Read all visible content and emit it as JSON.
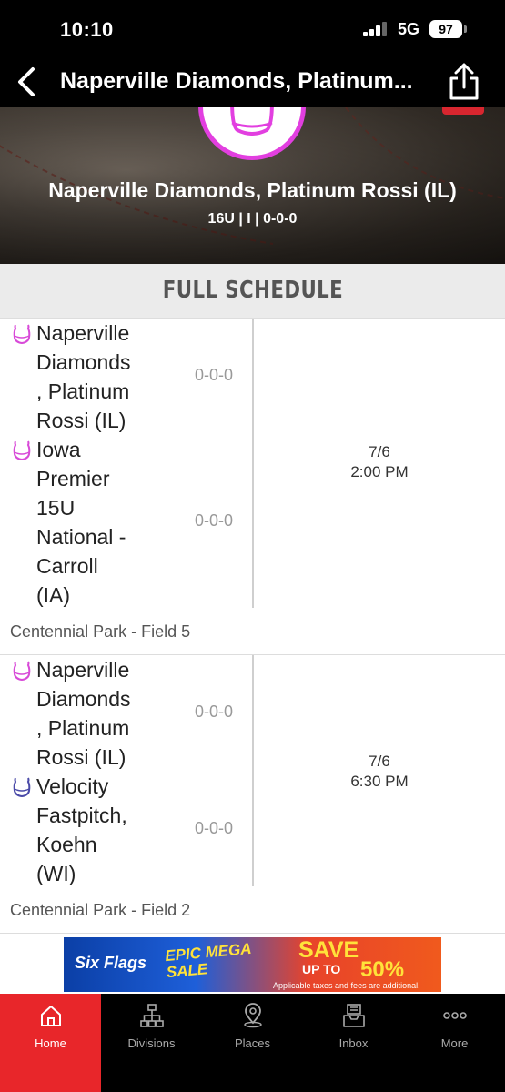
{
  "status_bar": {
    "time": "10:10",
    "network": "5G",
    "battery": "97"
  },
  "nav": {
    "title": "Naperville Diamonds, Platinum...",
    "back_icon": "chevron-left-icon",
    "share_icon": "share-icon"
  },
  "hero": {
    "team_name": "Naperville Diamonds, Platinum Rossi (IL)",
    "record": "16U | I | 0-0-0"
  },
  "schedule": {
    "header": "FULL SCHEDULE",
    "games": [
      {
        "home": {
          "name_lines": [
            "Naperville",
            "Diamonds",
            ", Platinum",
            "Rossi (IL)"
          ],
          "record": "0-0-0",
          "icon_color": "#d84ad8"
        },
        "away": {
          "name_lines": [
            "Iowa",
            "Premier",
            "15U",
            "National -",
            "Carroll",
            "(IA)"
          ],
          "record": "0-0-0",
          "icon_color": "#d84ad8"
        },
        "date": "7/6",
        "time": "2:00 PM",
        "location": "Centennial Park - Field 5"
      },
      {
        "home": {
          "name_lines": [
            "Naperville",
            "Diamonds",
            ", Platinum",
            "Rossi (IL)"
          ],
          "record": "0-0-0",
          "icon_color": "#d84ad8"
        },
        "away": {
          "name_lines": [
            "Velocity",
            "Fastpitch,",
            "Koehn",
            "(WI)"
          ],
          "record": "0-0-0",
          "icon_color": "#4a4aa8"
        },
        "date": "7/6",
        "time": "6:30 PM",
        "location": "Centennial Park - Field 2"
      }
    ]
  },
  "ad": {
    "brand": "Six Flags",
    "headline_1": "EPIC MEGA",
    "headline_2": "SALE",
    "save": "SAVE",
    "up_to": "UP TO",
    "percent": "50%",
    "fine_print": "Applicable taxes and fees are additional."
  },
  "tabs": [
    {
      "label": "Home",
      "icon": "home-icon",
      "active": true
    },
    {
      "label": "Divisions",
      "icon": "divisions-icon",
      "active": false
    },
    {
      "label": "Places",
      "icon": "places-icon",
      "active": false
    },
    {
      "label": "Inbox",
      "icon": "inbox-icon",
      "active": false
    },
    {
      "label": "More",
      "icon": "more-icon",
      "active": false
    }
  ],
  "colors": {
    "accent": "#e8262a",
    "logo_ring": "#e23fe0",
    "nav_bg": "#000000"
  }
}
